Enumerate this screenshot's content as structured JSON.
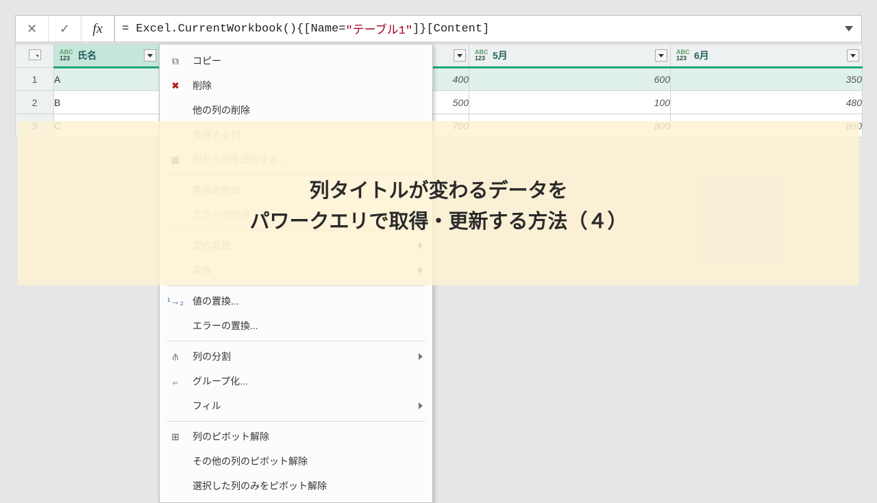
{
  "formula": {
    "prefix": "= Excel.CurrentWorkbook(){[Name=",
    "tablename": "\"テーブル1\"",
    "suffix": "]}[Content]"
  },
  "columns": {
    "c1": "氏名",
    "c3": "5月",
    "c4": "6月"
  },
  "rows": [
    {
      "n": "1",
      "name": "A",
      "v2": "400",
      "v3": "600",
      "v4": "350"
    },
    {
      "n": "2",
      "name": "B",
      "v2": "500",
      "v3": "100",
      "v4": "480"
    },
    {
      "n": "3",
      "name": "C",
      "v2": "700",
      "v3": "800",
      "v4": "860"
    }
  ],
  "overlay": {
    "line1": "列タイトルが変わるデータを",
    "line2": "パワークエリで取得・更新する方法（４）"
  },
  "ctx": {
    "copy": "コピー",
    "delete": "削除",
    "delete_others": "他の列の削除",
    "dup_col": "重複する列",
    "add_from_examples": "例から列を追加する...",
    "remove_dup": "重複の削除",
    "remove_err": "エラーの削除",
    "change_type": "型の変更",
    "transform": "変換",
    "replace_val": "値の置換...",
    "replace_err": "エラーの置換...",
    "split_col": "列の分割",
    "group_by": "グループ化...",
    "fill": "フィル",
    "unpivot": "列のピボット解除",
    "unpivot_other": "その他の列のピボット解除",
    "unpivot_sel": "選択した列のみをピボット解除"
  }
}
